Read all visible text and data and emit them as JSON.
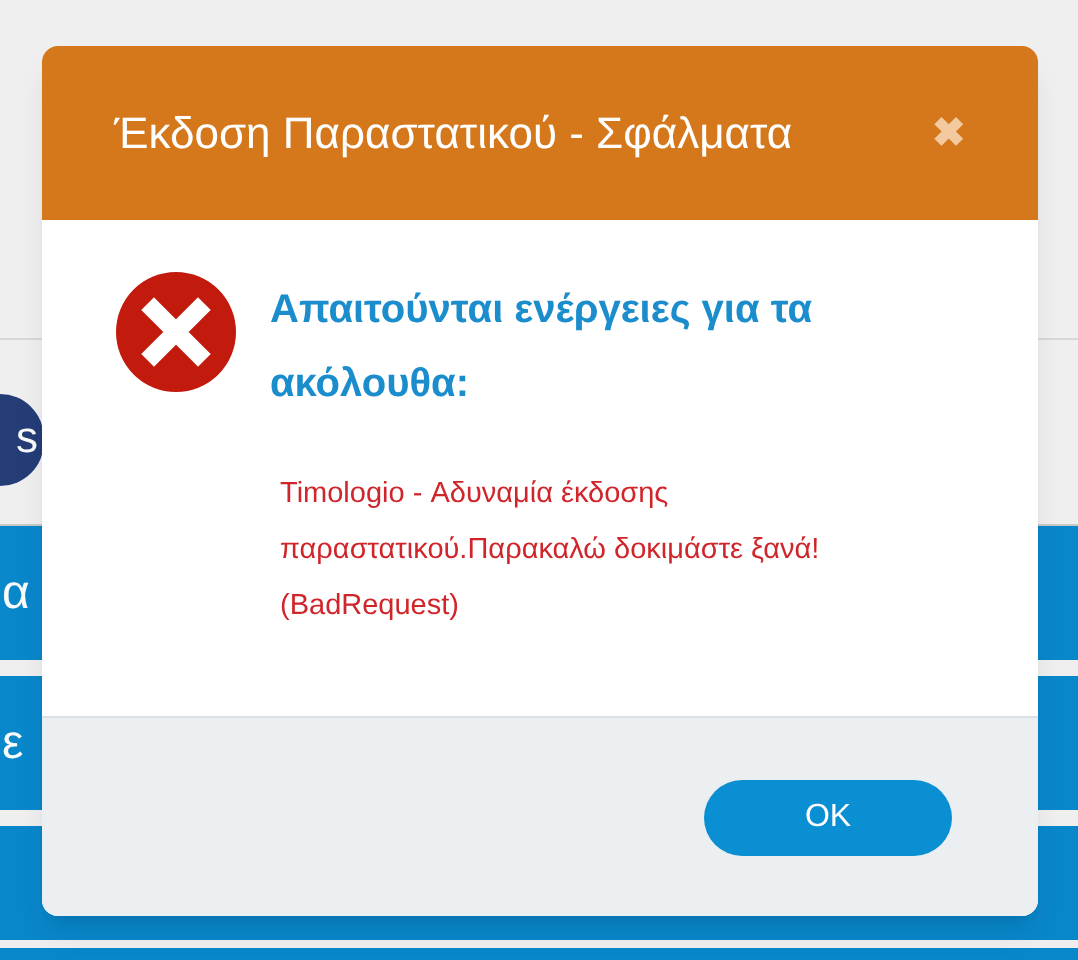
{
  "background": {
    "badge": "s",
    "bars": [
      {
        "label": "α"
      },
      {
        "label": "ε"
      }
    ]
  },
  "dialog": {
    "title": "Έκδοση Παραστατικού - Σφάλματα",
    "close": "✖",
    "heading": "Απαιτούνται ενέργειες για τα ακόλουθα:",
    "messages": [
      "Timologio - Αδυναμία έκδοσης παραστατικού.Παρακαλώ δοκιμάστε ξανά! (BadRequest)"
    ],
    "buttons": [
      {
        "label": "OK"
      }
    ]
  }
}
